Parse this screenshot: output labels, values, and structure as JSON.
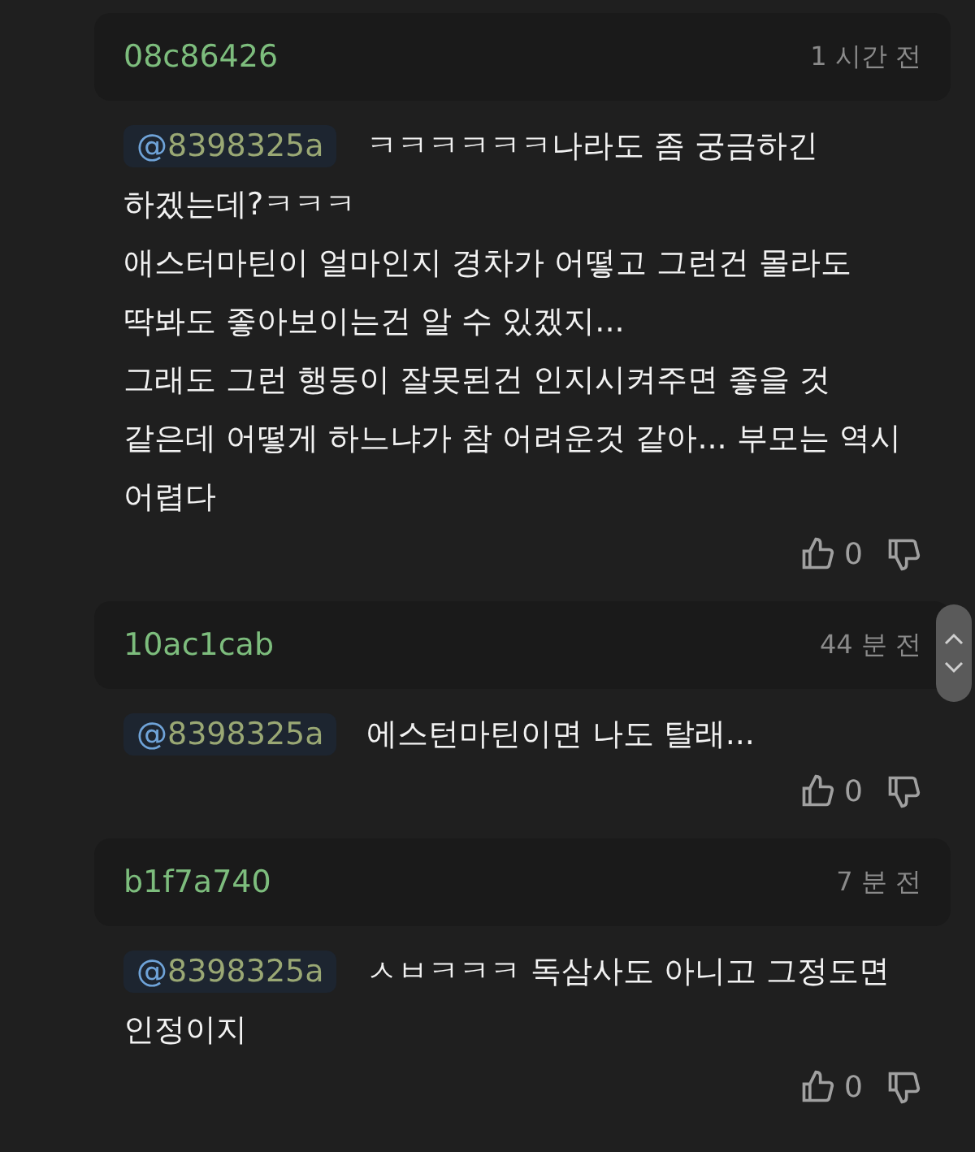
{
  "comments": [
    {
      "author": "08c86426",
      "time": "1 시간 전",
      "mention": "@8398325a",
      "text": "ㅋㅋㅋㅋㅋㅋ나라도 좀 궁금하긴 하겠는데?ㅋㅋㅋ\n애스터마틴이 얼마인지 경차가 어떻고 그런건 몰라도 딱봐도 좋아보이는건 알 수 있겠지...\n그래도 그런 행동이 잘못된건 인지시켜주면 좋을 것 같은데 어떻게 하느냐가 참 어려운것 같아... 부모는 역시 어렵다",
      "likes": "0"
    },
    {
      "author": "10ac1cab",
      "time": "44 분 전",
      "mention": "@8398325a",
      "text": "에스턴마틴이면 나도 탈래...",
      "likes": "0"
    },
    {
      "author": "b1f7a740",
      "time": "7 분 전",
      "mention": "@8398325a",
      "text": "ㅅㅂㅋㅋㅋ 독삼사도 아니고 그정도면 인정이지",
      "likes": "0"
    }
  ]
}
